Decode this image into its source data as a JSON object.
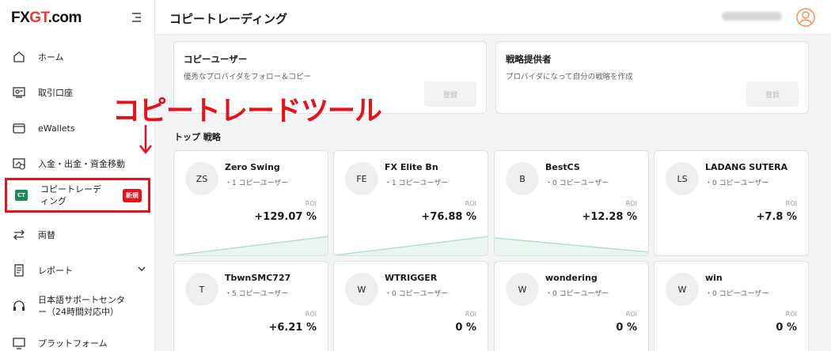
{
  "logo": {
    "part1": "FX",
    "part2": "GT",
    "part3": ".com"
  },
  "header": {
    "title": "コピートレーディング"
  },
  "sidebar": {
    "items": [
      {
        "label": "ホーム",
        "icon": "home-icon"
      },
      {
        "label": "取引口座",
        "icon": "accounts-icon"
      },
      {
        "label": "eWallets",
        "icon": "wallet-icon"
      },
      {
        "label": "入金・出金・資金移動",
        "icon": "transfer-icon"
      },
      {
        "label": "コピートレーディング",
        "icon": "ct-icon",
        "icon_text": "CT",
        "badge": "新規"
      },
      {
        "label": "両替",
        "icon": "exchange-icon"
      },
      {
        "label": "レポート",
        "icon": "report-icon"
      },
      {
        "label": "日本語サポートセンター（24時間対応中）",
        "icon": "headset-icon"
      },
      {
        "label": "プラットフォーム",
        "icon": "platform-icon"
      }
    ]
  },
  "copy_user": {
    "title": "コピーユーザー",
    "desc": "優秀なプロバイダをフォロー＆コピー",
    "button": "登録"
  },
  "provider": {
    "title": "戦略提供者",
    "desc": "プロバイダになって自分の戦略を作成",
    "button": "登録"
  },
  "section_title": "トップ 戦略",
  "roi_label": "ROI",
  "strategies": [
    {
      "initials": "ZS",
      "name": "Zero Swing",
      "followers": "・1 コピーユーザー",
      "roi": "+129.07 %",
      "trend": "up"
    },
    {
      "initials": "FE",
      "name": "FX Elite Bn",
      "followers": "・1 コピーユーザー",
      "roi": "+76.88 %",
      "trend": "up"
    },
    {
      "initials": "B",
      "name": "BestCS",
      "followers": "・0 コピーユーザー",
      "roi": "+12.28 %",
      "trend": "down"
    },
    {
      "initials": "LS",
      "name": "LADANG SUTERA",
      "followers": "・0 コピーユーザー",
      "roi": "+7.8 %",
      "trend": "none"
    },
    {
      "initials": "T",
      "name": "TbwnSMC727",
      "followers": "・5 コピーユーザー",
      "roi": "+6.21 %",
      "trend": "none"
    },
    {
      "initials": "W",
      "name": "WTRIGGER",
      "followers": "・0 コピーユーザー",
      "roi": "0 %",
      "trend": "none"
    },
    {
      "initials": "W",
      "name": "wondering",
      "followers": "・0 コピーユーザー",
      "roi": "0 %",
      "trend": "none"
    },
    {
      "initials": "W",
      "name": "win",
      "followers": "・0 コピーユーザー",
      "roi": "0 %",
      "trend": "none"
    }
  ],
  "annotation": {
    "text": "コピートレードツール",
    "arrow": "↓"
  },
  "colors": {
    "accent_red": "#e8101a",
    "brand_green": "#1b8c57",
    "chart_green": "#b9dccb",
    "avatar_orange": "#f08a4b"
  }
}
